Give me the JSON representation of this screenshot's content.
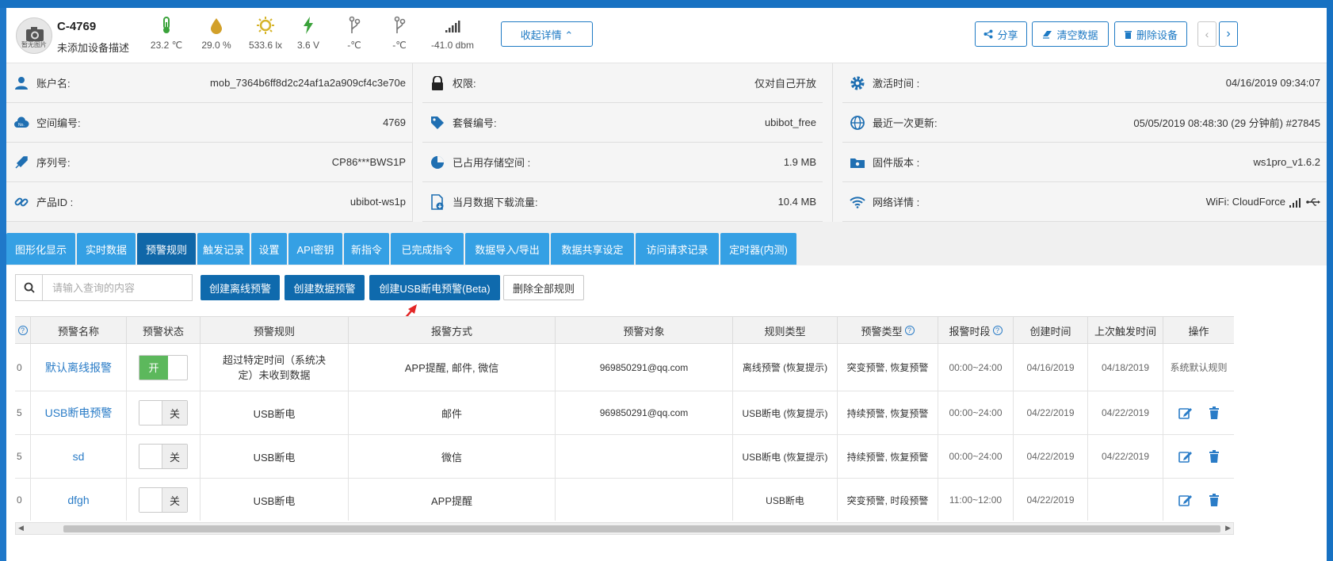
{
  "device": {
    "name": "C-4769",
    "description": "未添加设备描述",
    "avatar_caption": "暂无图片",
    "collapse_label": "收起详情 ⌃"
  },
  "sensors": [
    {
      "icon": "thermometer-icon",
      "value": "23.2 ℃"
    },
    {
      "icon": "humidity-drop-icon",
      "value": "29.0 %"
    },
    {
      "icon": "light-sun-icon",
      "value": "533.6 lx"
    },
    {
      "icon": "voltage-bolt-icon",
      "value": "3.6 V"
    },
    {
      "icon": "probe-icon",
      "value": "-℃"
    },
    {
      "icon": "probe-icon",
      "value": "-℃"
    },
    {
      "icon": "signal-bars-icon",
      "value": "-41.0 dbm"
    }
  ],
  "toolbar": {
    "share": "分享",
    "clear_data": "清空数据",
    "delete_device": "删除设备",
    "prev": "‹",
    "next": "›"
  },
  "info": {
    "account_label": "账户名:",
    "account_value": "mob_7364b6ff8d2c24af1a2a909cf4c3e70e",
    "permission_label": "权限:",
    "permission_value": "仅对自己开放",
    "activation_label": "激活时间 :",
    "activation_value": "04/16/2019 09:34:07",
    "space_label": "空间编号:",
    "space_value": "4769",
    "plan_label": "套餐编号:",
    "plan_value": "ubibot_free",
    "update_label": "最近一次更新:",
    "update_value": "05/05/2019 08:48:30 (29 分钟前) #27845",
    "serial_label": "序列号:",
    "serial_value": "CP86***BWS1P",
    "storage_label": "已占用存储空间 :",
    "storage_value": "1.9 MB",
    "firmware_label": "固件版本 :",
    "firmware_value": "ws1pro_v1.6.2",
    "product_label": "产品ID :",
    "product_value": "ubibot-ws1p",
    "traffic_label": "当月数据下载流量:",
    "traffic_value": "10.4 MB",
    "network_label": "网络详情 :",
    "network_value": "WiFi: CloudForce"
  },
  "tabs": [
    "图形化显示",
    "实时数据",
    "预警规则",
    "触发记录",
    "设置",
    "API密钥",
    "新指令",
    "已完成指令",
    "数据导入/导出",
    "数据共享设定",
    "访问请求记录",
    "定时器(内测)"
  ],
  "search": {
    "placeholder": "请输入查询的内容"
  },
  "actions": {
    "create_offline": "创建离线预警",
    "create_data": "创建数据预警",
    "create_usb": "创建USB断电预警(Beta)",
    "delete_all": "删除全部规则"
  },
  "table": {
    "headers": [
      "预警名称",
      "预警状态",
      "预警规则",
      "报警方式",
      "预警对象",
      "规则类型",
      "预警类型",
      "报警时段",
      "创建时间",
      "上次触发时间",
      "操作"
    ],
    "rows": [
      {
        "id_frag": "0",
        "name": "默认离线报警",
        "status": "开",
        "rule": "超过特定时间（系统决定）未收到数据",
        "method": "APP提醒, 邮件, 微信",
        "target": "969850291@qq.com",
        "rule_type": "离线预警 (恢复提示)",
        "alert_type": "突变预警, 恢复预警",
        "period": "00:00~24:00",
        "created": "04/16/2019",
        "last": "04/18/2019",
        "op": "系统默认规则"
      },
      {
        "id_frag": "5",
        "name": "USB断电预警",
        "status": "关",
        "rule": "USB断电",
        "method": "邮件",
        "target": "969850291@qq.com",
        "rule_type": "USB断电 (恢复提示)",
        "alert_type": "持续预警, 恢复预警",
        "period": "00:00~24:00",
        "created": "04/22/2019",
        "last": "04/22/2019",
        "op": ""
      },
      {
        "id_frag": "5",
        "name": "sd",
        "status": "关",
        "rule": "USB断电",
        "method": "微信",
        "target": "",
        "rule_type": "USB断电 (恢复提示)",
        "alert_type": "持续预警, 恢复预警",
        "period": "00:00~24:00",
        "created": "04/22/2019",
        "last": "04/22/2019",
        "op": ""
      },
      {
        "id_frag": "0",
        "name": "dfgh",
        "status": "关",
        "rule": "USB断电",
        "method": "APP提醒",
        "target": "",
        "rule_type": "USB断电",
        "alert_type": "突变预警, 时段预警",
        "period": "11:00~12:00",
        "created": "04/22/2019",
        "last": "",
        "op": ""
      }
    ]
  }
}
